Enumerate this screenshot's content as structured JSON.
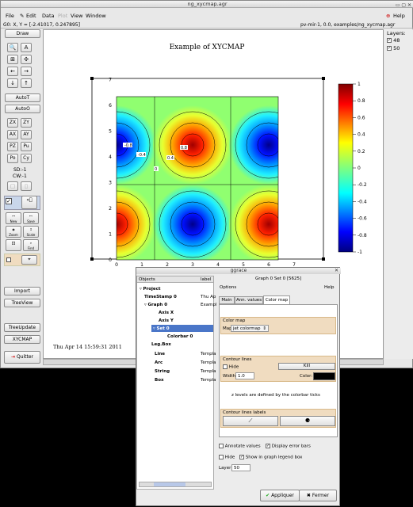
{
  "window": {
    "title": "ng_xycmap.agr",
    "buttons": "▭ ▢ ✕"
  },
  "menubar": {
    "file": "File",
    "edit": "Edit",
    "data": "Data",
    "plot": "Plot",
    "view": "View",
    "window": "Window",
    "help": "Help"
  },
  "status": {
    "left": "G0: X, Y = [-2.41017, 0.247895]",
    "right": "pv-mir-1, 0.0, examples/ng_xycmap.agr"
  },
  "toolbar": {
    "draw": "Draw",
    "autot": "AutoT",
    "autoo": "AutoO",
    "zx": "ZX",
    "zy": "ZY",
    "ax": "AX",
    "ay": "AY",
    "pz": "PZ",
    "pu": "Pu",
    "po": "Po",
    "cy": "Cy",
    "sd": "SD:-1",
    "cw": "CW:-1",
    "import": "Import",
    "treeview": "TreeView",
    "treeupdate": "TreeUpdate",
    "xycmap": "XYCMAP",
    "quit": "Quitter",
    "small_new": "New",
    "small_save": "Save",
    "small_zoom": "Zoom",
    "small_scale": "Scale",
    "small_find": "Find"
  },
  "layers": {
    "label": "Layers:",
    "items": [
      "48",
      "50"
    ]
  },
  "plot": {
    "title": "Example of XYCMAP",
    "timestamp": "Thu Apr 14 15:59:31 2011",
    "x_ticks": [
      "0",
      "1",
      "2",
      "3",
      "4",
      "5",
      "6",
      "7"
    ],
    "y_ticks": [
      "0",
      "1",
      "2",
      "3",
      "4",
      "5",
      "6",
      "7"
    ],
    "colorbar_ticks": [
      "1",
      "0.8",
      "0.6",
      "0.4",
      "0.2",
      "0",
      "-0.2",
      "-0.4",
      "-0.6",
      "-0.8",
      "-1"
    ],
    "contour_labels": [
      "-0.8",
      "-0.4",
      "0",
      "0.4",
      "0.8"
    ]
  },
  "dialog": {
    "title": "ggrace",
    "col_objects": "Objects",
    "col_label": "label",
    "header_info": "Graph 0  Set 0   [5625]",
    "options": "Options",
    "help": "Help",
    "tree": [
      {
        "name": "Project",
        "label": ""
      },
      {
        "name": "TimeStamp 0",
        "label": "Thu Ap"
      },
      {
        "name": "Graph 0",
        "label": "Exampl"
      },
      {
        "name": "Axis X",
        "label": ""
      },
      {
        "name": "Axis Y",
        "label": ""
      },
      {
        "name": "Set 0",
        "label": ""
      },
      {
        "name": "Colorbar 0",
        "label": ""
      },
      {
        "name": "Leg.Box",
        "label": ""
      },
      {
        "name": "Line",
        "label": "Templa"
      },
      {
        "name": "Arc",
        "label": "Templa"
      },
      {
        "name": "String",
        "label": "Templa"
      },
      {
        "name": "Box",
        "label": "Templa"
      }
    ],
    "tabs": [
      "Main",
      "Ann. values",
      "Color map"
    ],
    "colormap_section": "Color map",
    "map_label": "Map",
    "map_value": "jet colormap",
    "contour_section": "Contour lines",
    "hide": "Hide",
    "kill": "Kill",
    "width_label": "Width:",
    "width_value": "1.0",
    "color_label": "Color:",
    "zlevels_note": "z levels are defined by the colorbar ticks",
    "labels_section": "Contour lines labels",
    "annotate_values": "Annotate values",
    "display_error_bars": "Display error bars",
    "hide2": "Hide",
    "show_legend": "Show in graph legend box",
    "layer_label": "Layer",
    "layer_value": "50",
    "apply": "Appliquer",
    "close": "Fermer",
    "colors": {
      "section_bg": "#f0dcc0",
      "active_tab": "#ffffff"
    }
  }
}
